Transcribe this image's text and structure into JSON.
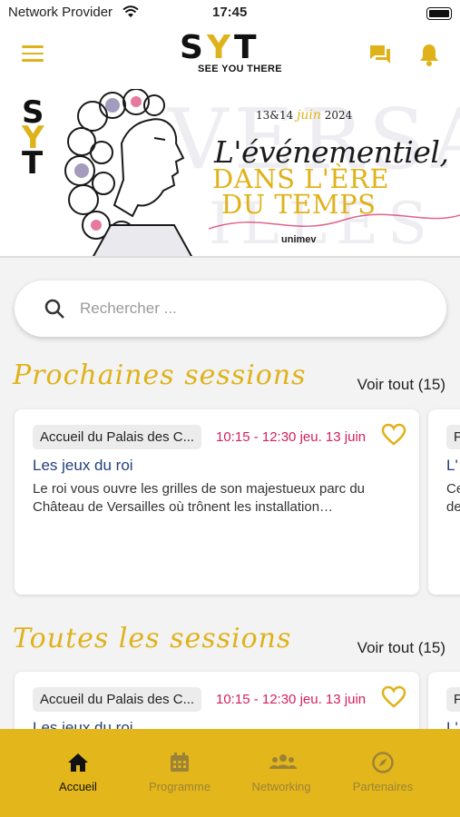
{
  "status_bar": {
    "carrier": "Network Provider",
    "time": "17:45"
  },
  "header": {
    "logo_letters": "SYT",
    "logo_tagline": "SEE YOU THERE"
  },
  "banner": {
    "mini_logo": "SYT",
    "dates_prefix": "13&14",
    "dates_month": "juin",
    "dates_year": "2024",
    "line1": "L'événementiel,",
    "line2": "DANS L'ÈRE",
    "line3": "DU TEMPS",
    "organizer": "unimev",
    "bg_word": "VERSA",
    "bg_word2": "ILLES"
  },
  "search": {
    "placeholder": "Rechercher ..."
  },
  "sections": [
    {
      "title": "Prochaines sessions",
      "see_all": "Voir tout (15)",
      "cards": [
        {
          "location": "Accueil du Palais des C...",
          "time": "10:15 - 12:30 jeu. 13 juin",
          "title": "Les jeux du roi",
          "description": "Le roi vous ouvre les grilles de son majestueux parc du Château de Versailles où trônent les installation…"
        },
        {
          "location": "P",
          "title": "L'",
          "description": "Ce de"
        }
      ]
    },
    {
      "title": "Toutes les sessions",
      "see_all": "Voir tout (15)",
      "cards": [
        {
          "location": "Accueil du Palais des C...",
          "time": "10:15 - 12:30 jeu. 13 juin",
          "title": "Les jeux du roi"
        },
        {
          "location": "P",
          "title": "L'"
        }
      ]
    }
  ],
  "bottom_nav": [
    {
      "label": "Accueil",
      "icon": "home-icon",
      "active": true
    },
    {
      "label": "Programme",
      "icon": "calendar-icon",
      "active": false
    },
    {
      "label": "Networking",
      "icon": "people-icon",
      "active": false
    },
    {
      "label": "Partenaires",
      "icon": "compass-icon",
      "active": false
    }
  ],
  "colors": {
    "accent": "#e3b71b",
    "time_red": "#d3215a",
    "title_blue": "#23407a"
  }
}
